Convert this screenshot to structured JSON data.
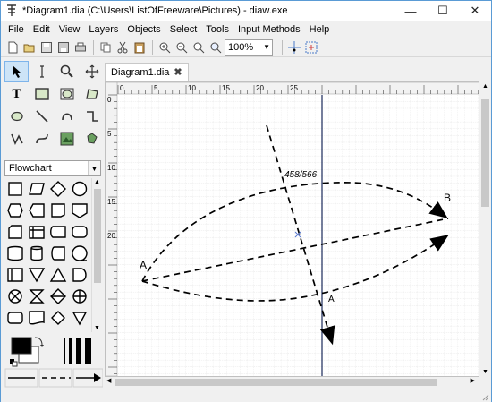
{
  "window": {
    "title": "*Diagram1.dia (C:\\Users\\ListOfFreeware\\Pictures) - diaw.exe",
    "controls": [
      "minimize",
      "maximize",
      "close"
    ]
  },
  "menu": [
    "File",
    "Edit",
    "View",
    "Layers",
    "Objects",
    "Select",
    "Tools",
    "Input Methods",
    "Help"
  ],
  "toolbar": {
    "zoom_value": "100%",
    "icons": [
      "new-icon",
      "open-icon",
      "save-icon",
      "save-as-icon",
      "print-icon",
      "copy-icon",
      "cut-icon",
      "paste-icon",
      "zoom-in-icon",
      "zoom-out-icon",
      "zoom-fit-icon",
      "zoom-select-icon",
      "snap-grid-icon",
      "guide-icon"
    ]
  },
  "toolbox": {
    "tools": [
      "pointer-tool",
      "text-edit-tool",
      "magnify-tool",
      "scroll-tool",
      "text-tool",
      "box-tool",
      "ellipse-tool",
      "polygon-tool",
      "beziergon-tool",
      "line-tool",
      "arc-tool",
      "zigzag-tool",
      "polyline-tool",
      "bezier-tool",
      "image-tool",
      "outline-tool"
    ],
    "sheet": "Flowchart"
  },
  "canvas": {
    "tab_label": "Diagram1.dia",
    "ruler_h": [
      "0",
      "5",
      "10",
      "15",
      "20",
      "25"
    ],
    "ruler_v": [
      "0",
      "5",
      "10",
      "15",
      "20"
    ],
    "labels": {
      "A": "A",
      "B": "B",
      "A_prime": "A'",
      "measure": "458/566"
    }
  }
}
